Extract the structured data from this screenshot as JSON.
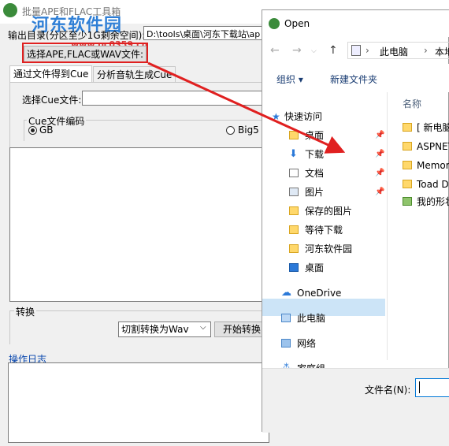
{
  "app": {
    "title": "批量APE和FLAC工具箱",
    "watermark": "河东软件园",
    "watermark_url": "www.pc0359.cn",
    "output_dir_label": "输出目录(分区至少1G剩余空间):",
    "output_dir_value": "D:\\tools\\桌面\\河东下载站\\ap",
    "select_button": "选择APE,FLAC或WAV文件:",
    "tabs": [
      {
        "label": "通过文件得到Cue"
      },
      {
        "label": "分析音轨生成Cue"
      }
    ],
    "cue_file_label": "选择Cue文件:",
    "cue_encoding_label": "Cue文件编码",
    "encoding_options": [
      {
        "label": "GB",
        "selected": true
      },
      {
        "label": "Big5",
        "selected": false
      }
    ],
    "convert_label": "转换",
    "convert_mode": "切割转换为Wav",
    "start_button": "开始转换",
    "log_label": "操作日志"
  },
  "dialog": {
    "title": "Open",
    "address": [
      "此电脑",
      "本地磁"
    ],
    "organize": "组织 ▾",
    "new_folder": "新建文件夹",
    "nav_items": [
      {
        "label": "快速访问",
        "icon": "star-icon",
        "pinned": false
      },
      {
        "label": "桌面",
        "icon": "folder-icon",
        "pinned": true
      },
      {
        "label": "下载",
        "icon": "download-icon",
        "pinned": true
      },
      {
        "label": "文档",
        "icon": "document-icon",
        "pinned": true
      },
      {
        "label": "图片",
        "icon": "picture-icon",
        "pinned": true
      },
      {
        "label": "保存的图片",
        "icon": "folder-icon",
        "pinned": false
      },
      {
        "label": "等待下载",
        "icon": "folder-icon",
        "pinned": false
      },
      {
        "label": "河东软件园",
        "icon": "folder-icon",
        "pinned": false
      },
      {
        "label": "桌面",
        "icon": "desktop-icon",
        "pinned": false
      },
      {
        "label": "OneDrive",
        "icon": "cloud-icon",
        "pinned": false
      },
      {
        "label": "此电脑",
        "icon": "computer-icon",
        "pinned": false
      },
      {
        "label": "网络",
        "icon": "network-icon",
        "pinned": false
      },
      {
        "label": "家庭组",
        "icon": "homegroup-icon",
        "pinned": false
      }
    ],
    "column_name": "名称",
    "files": [
      {
        "label": "[ 新电脑"
      },
      {
        "label": "ASPNET"
      },
      {
        "label": "Memory"
      },
      {
        "label": "Toad D"
      },
      {
        "label": "我的形状"
      }
    ],
    "filename_label": "文件名(N):"
  },
  "colors": {
    "highlight": "#e02020",
    "selected_nav": "#cce4f7"
  }
}
